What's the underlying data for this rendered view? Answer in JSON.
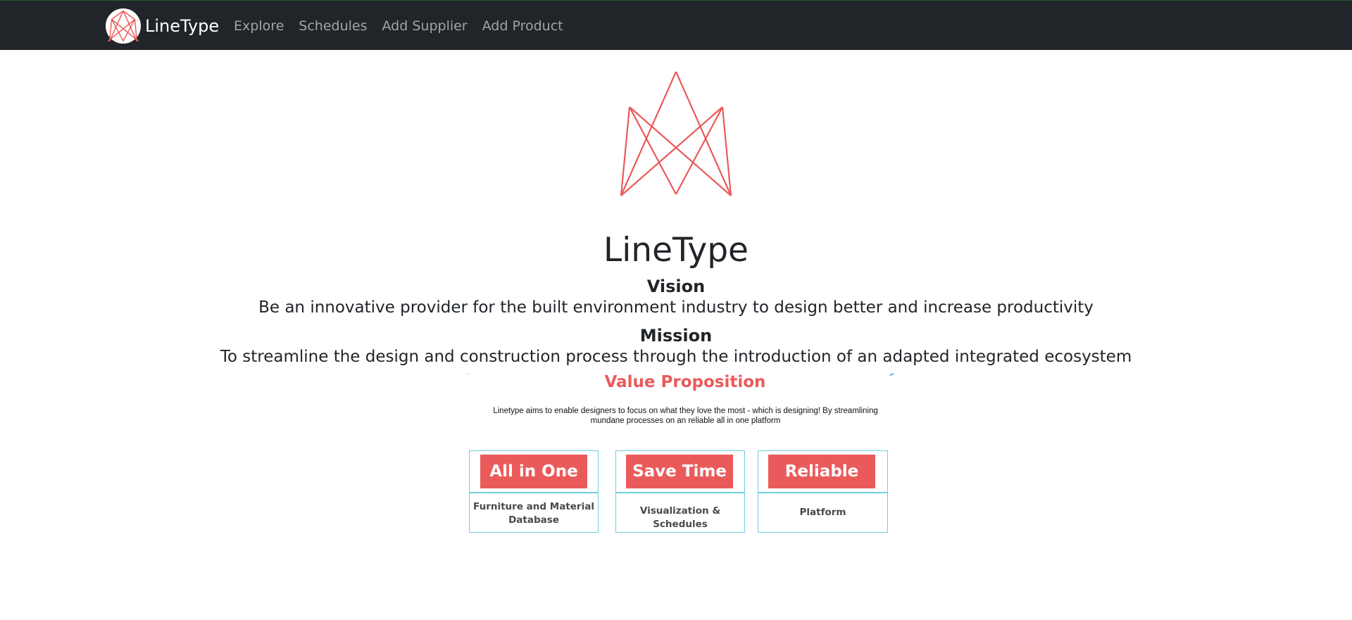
{
  "navbar": {
    "brand_name": "LineType",
    "links": [
      "Explore",
      "Schedules",
      "Add Supplier",
      "Add Product"
    ]
  },
  "hero": {
    "title": "LineType",
    "vision_heading": "Vision",
    "vision_text": "Be an innovative provider for the built environment industry to design better and increase productivity",
    "mission_heading": "Mission",
    "mission_text": "To streamline the design and construction process through the introduction of an adapted integrated ecosystem"
  },
  "value_proposition": {
    "title": "Value Proposition",
    "text": "Linetype aims to enable designers to focus on what they love the most - which is designing! By streamlining mundane processes on an reliable all in one platform",
    "cards": [
      {
        "label": "All in One",
        "description": "Furniture and Material Database"
      },
      {
        "label": "Save Time",
        "description": "Visualization & Schedules"
      },
      {
        "label": "Reliable",
        "description": "Platform"
      }
    ]
  },
  "colors": {
    "navbar_bg": "#212529",
    "accent": "#eb5a5a",
    "card_border": "#6fcfde",
    "nav_link": "#a2a4a7"
  },
  "icons": {
    "brand_logo": "linetype-logo-icon",
    "hero_logo": "linetype-logo-icon"
  }
}
